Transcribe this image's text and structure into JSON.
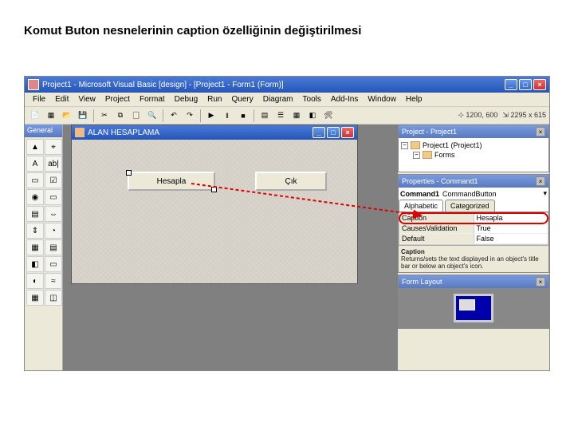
{
  "slide": {
    "title": "Komut Buton  nesnelerinin caption özelliğinin değiştirilmesi"
  },
  "titlebar": {
    "text": "Project1 - Microsoft Visual Basic [design] - [Project1 - Form1 (Form)]"
  },
  "winbtn": {
    "min": "_",
    "max": "□",
    "close": "×"
  },
  "menu": [
    "File",
    "Edit",
    "View",
    "Project",
    "Format",
    "Debug",
    "Run",
    "Query",
    "Diagram",
    "Tools",
    "Add-Ins",
    "Window",
    "Help"
  ],
  "toolbar": {
    "coords": "1200, 600",
    "size": "2295 x 615"
  },
  "toolbox": {
    "title": "General",
    "tools": [
      "▲",
      "⌖",
      "A",
      "ab|",
      "▭",
      "☑",
      "◉",
      "▭",
      "▤",
      "⇔",
      "⇕",
      "◔",
      "▦",
      "▤",
      "◧",
      "▭",
      "◐",
      "≈",
      "▦",
      "◫"
    ]
  },
  "form": {
    "title": "ALAN HESAPLAMA",
    "buttons": {
      "b1": "Hesapla",
      "b2": "Çık"
    }
  },
  "project_panel": {
    "title": "Project - Project1",
    "root": "Project1 (Project1)",
    "folder": "Forms"
  },
  "props_panel": {
    "title": "Properties - Command1",
    "object_name": "Command1",
    "object_type": "CommandButton",
    "tab1": "Alphabetic",
    "tab2": "Categorized",
    "rows": [
      {
        "k": "Caption",
        "v": "Hesapla",
        "hl": true
      },
      {
        "k": "CausesValidation",
        "v": "True",
        "hl": false
      },
      {
        "k": "Default",
        "v": "False",
        "hl": false
      }
    ],
    "desc_title": "Caption",
    "desc_body": "Returns/sets the text displayed in an object's title bar or below an object's icon."
  },
  "layout_panel": {
    "title": "Form Layout"
  }
}
